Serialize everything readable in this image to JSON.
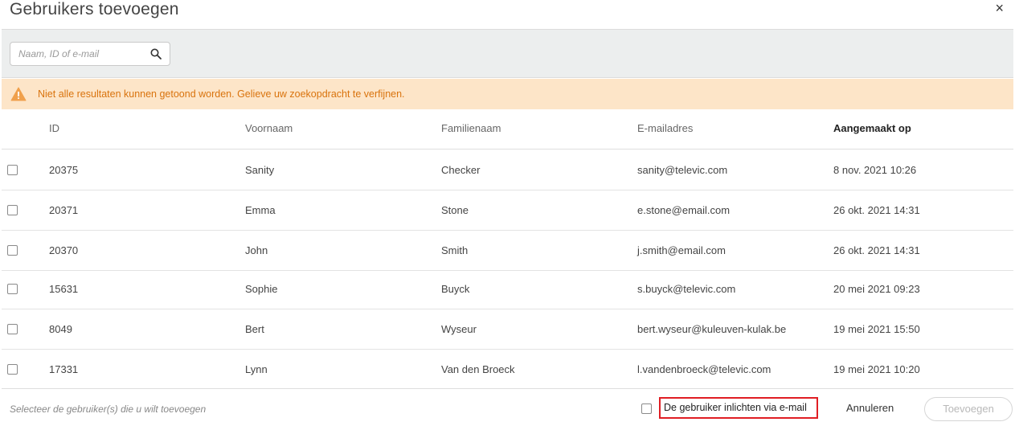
{
  "dialog": {
    "title": "Gebruikers toevoegen",
    "close_label": "×"
  },
  "search": {
    "placeholder": "Naam, ID of e-mail",
    "value": ""
  },
  "warning": {
    "text": "Niet alle resultaten kunnen getoond worden. Gelieve uw zoekopdracht te verfijnen.",
    "color": "#d9730d",
    "background": "#fde5c8"
  },
  "table": {
    "columns": [
      "ID",
      "Voornaam",
      "Familienaam",
      "E-mailadres",
      "Aangemaakt op"
    ],
    "sorted_column": "Aangemaakt op",
    "rows": [
      {
        "id": "20375",
        "first": "Sanity",
        "last": "Checker",
        "email": "sanity@televic.com",
        "created": "8 nov. 2021 10:26"
      },
      {
        "id": "20371",
        "first": "Emma",
        "last": "Stone",
        "email": "e.stone@email.com",
        "created": "26 okt. 2021 14:31"
      },
      {
        "id": "20370",
        "first": "John",
        "last": "Smith",
        "email": "j.smith@email.com",
        "created": "26 okt. 2021 14:31"
      },
      {
        "id": "15631",
        "first": "Sophie",
        "last": "Buyck",
        "email": "s.buyck@televic.com",
        "created": "20 mei 2021 09:23"
      },
      {
        "id": "8049",
        "first": "Bert",
        "last": "Wyseur",
        "email": "bert.wyseur@kuleuven-kulak.be",
        "created": "19 mei 2021 15:50"
      },
      {
        "id": "17331",
        "first": "Lynn",
        "last": "Van den Broeck",
        "email": "l.vandenbroeck@televic.com",
        "created": "19 mei 2021 10:20"
      }
    ]
  },
  "footer": {
    "hint": "Selecteer de gebruiker(s) die u wilt toevoegen",
    "notify_label": "De gebruiker inlichten via e-mail",
    "cancel_label": "Annuleren",
    "add_label": "Toevoegen"
  }
}
